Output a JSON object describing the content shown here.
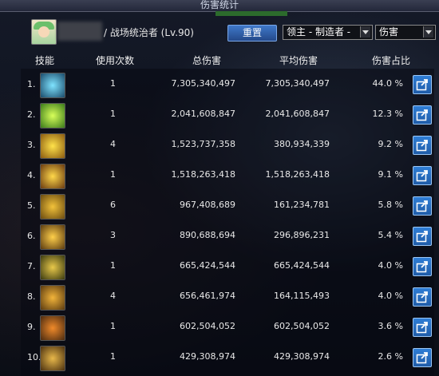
{
  "window": {
    "title": "伤害统计"
  },
  "character": {
    "info": "/ 战场统治者 (Lv.90)"
  },
  "toolbar": {
    "reset_label": "重置",
    "target_select": "领主 - 制造者 -",
    "mode_select": "伤害"
  },
  "columns": {
    "skill": "技能",
    "count": "使用次数",
    "total": "总伤害",
    "avg": "平均伤害",
    "pct": "伤害占比"
  },
  "rows": [
    {
      "idx": "1.",
      "icon": "skill-icon-1",
      "count": "1",
      "total": "7,305,340,497",
      "avg": "7,305,340,497",
      "pct": "44.0 %"
    },
    {
      "idx": "2.",
      "icon": "skill-icon-2",
      "count": "1",
      "total": "2,041,608,847",
      "avg": "2,041,608,847",
      "pct": "12.3 %"
    },
    {
      "idx": "3.",
      "icon": "skill-icon-3",
      "count": "4",
      "total": "1,523,737,358",
      "avg": "380,934,339",
      "pct": "9.2 %"
    },
    {
      "idx": "4.",
      "icon": "skill-icon-4",
      "count": "1",
      "total": "1,518,263,418",
      "avg": "1,518,263,418",
      "pct": "9.1 %"
    },
    {
      "idx": "5.",
      "icon": "skill-icon-5",
      "count": "6",
      "total": "967,408,689",
      "avg": "161,234,781",
      "pct": "5.8 %"
    },
    {
      "idx": "6.",
      "icon": "skill-icon-6",
      "count": "3",
      "total": "890,688,694",
      "avg": "296,896,231",
      "pct": "5.4 %"
    },
    {
      "idx": "7.",
      "icon": "skill-icon-7",
      "count": "1",
      "total": "665,424,544",
      "avg": "665,424,544",
      "pct": "4.0 %"
    },
    {
      "idx": "8.",
      "icon": "skill-icon-8",
      "count": "4",
      "total": "656,461,974",
      "avg": "164,115,493",
      "pct": "4.0 %"
    },
    {
      "idx": "9.",
      "icon": "skill-icon-9",
      "count": "1",
      "total": "602,504,052",
      "avg": "602,504,052",
      "pct": "3.6 %"
    },
    {
      "idx": "10.",
      "icon": "skill-icon-10",
      "count": "1",
      "total": "429,308,974",
      "avg": "429,308,974",
      "pct": "2.6 %"
    }
  ],
  "colors": {
    "accent_blue": "#2f7ed6",
    "background": "#0d1018",
    "text": "#e8e8e8"
  }
}
